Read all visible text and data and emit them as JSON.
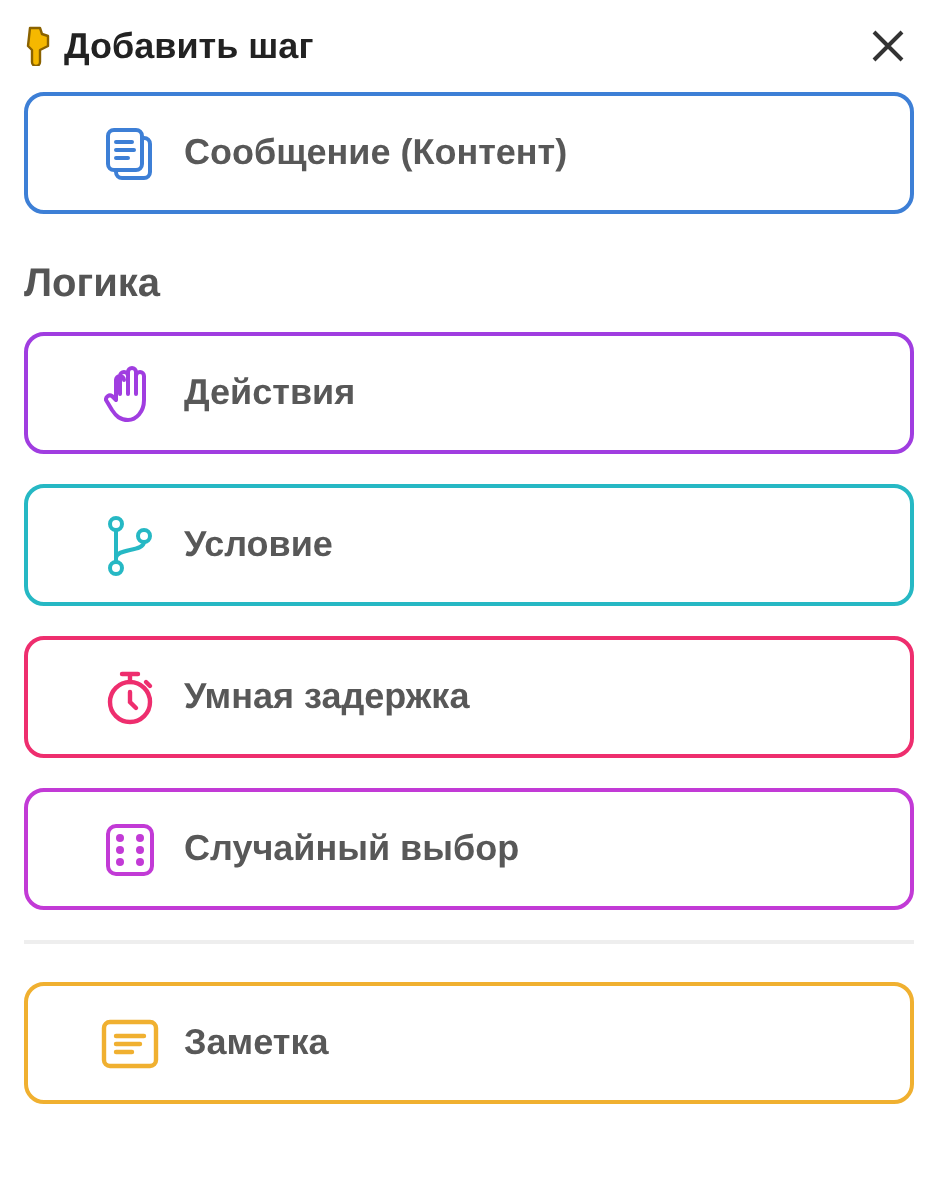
{
  "title": "Добавить шаг",
  "top_items": [
    {
      "kind": "message",
      "label": "Сообщение (Контент)",
      "color": "#3d7fd6"
    }
  ],
  "logic": {
    "heading": "Логика",
    "items": [
      {
        "kind": "actions",
        "label": "Действия",
        "color": "#a03de0"
      },
      {
        "kind": "condition",
        "label": "Условие",
        "color": "#26b8c4"
      },
      {
        "kind": "delay",
        "label": "Умная задержка",
        "color": "#ee2e6e"
      },
      {
        "kind": "random",
        "label": "Случайный выбор",
        "color": "#c23ad6"
      }
    ]
  },
  "bottom_items": [
    {
      "kind": "note",
      "label": "Заметка",
      "color": "#f0b030"
    }
  ]
}
